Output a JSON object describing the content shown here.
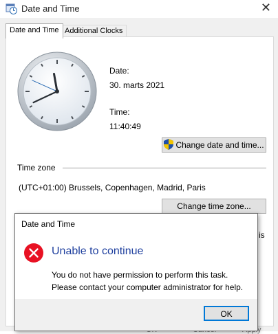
{
  "window": {
    "title": "Date and Time",
    "close_glyph": "✕"
  },
  "tabs": [
    {
      "label": "Date and Time"
    },
    {
      "label": "Additional Clocks"
    }
  ],
  "date": {
    "label": "Date:",
    "value": "30. marts 2021"
  },
  "time": {
    "label": "Time:",
    "value": "11:40:49"
  },
  "buttons": {
    "change_date_time": "Change date and time...",
    "change_time_zone": "Change time zone..."
  },
  "timezone": {
    "section_label": "Time zone",
    "value": "(UTC+01:00) Brussels, Copenhagen, Madrid, Paris"
  },
  "partial_behind": {
    "right_text": "is",
    "bottom_left": "OK",
    "bottom_mid": "Cancel",
    "bottom_right": "Apply"
  },
  "dialog": {
    "title": "Date and Time",
    "heading": "Unable to continue",
    "message_line1": "You do not have permission to perform this task.",
    "message_line2": "Please contact your computer administrator for help.",
    "ok_label": "OK"
  },
  "colors": {
    "accent": "#0078d7",
    "error": "#e81123",
    "heading": "#1e3f9e",
    "arrow": "#e81123"
  },
  "icons": {
    "app": "calendar-clock-icon",
    "shield": "uac-shield-icon",
    "error": "error-circle-x-icon",
    "arrow": "red-pointer-arrow-icon"
  }
}
